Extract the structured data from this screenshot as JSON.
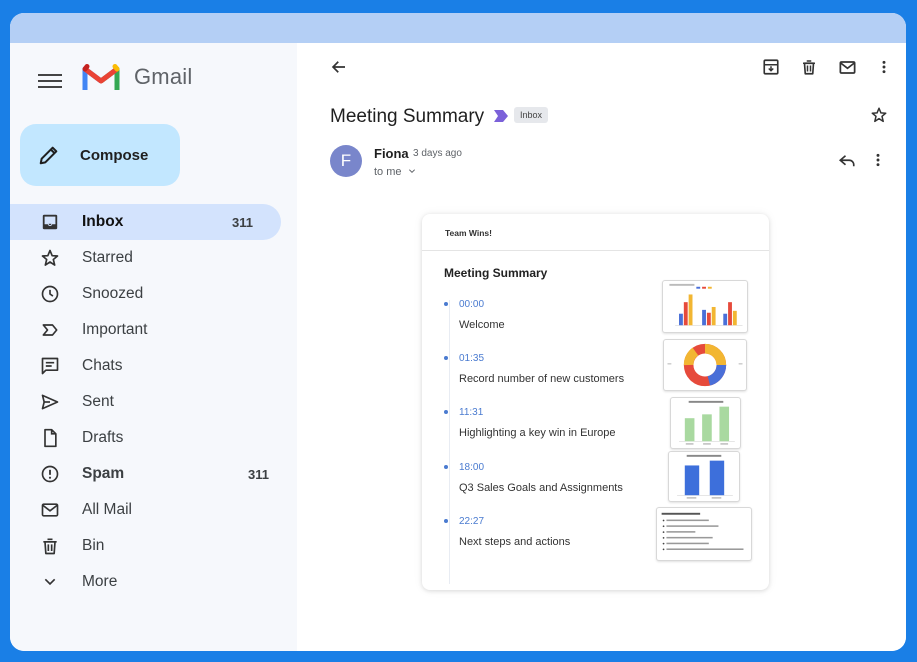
{
  "app": {
    "name": "Gmail"
  },
  "sidebar": {
    "compose_label": "Compose",
    "items": [
      {
        "label": "Inbox",
        "count": "311",
        "icon": "inbox-icon"
      },
      {
        "label": "Starred",
        "count": "",
        "icon": "star-icon"
      },
      {
        "label": "Snoozed",
        "count": "",
        "icon": "clock-icon"
      },
      {
        "label": "Important",
        "count": "",
        "icon": "important-icon"
      },
      {
        "label": "Chats",
        "count": "",
        "icon": "chat-icon"
      },
      {
        "label": "Sent",
        "count": "",
        "icon": "send-icon"
      },
      {
        "label": "Drafts",
        "count": "",
        "icon": "draft-icon"
      },
      {
        "label": "Spam",
        "count": "311",
        "icon": "spam-icon"
      },
      {
        "label": "All Mail",
        "count": "",
        "icon": "mail-icon"
      },
      {
        "label": "Bin",
        "count": "",
        "icon": "trash-icon"
      },
      {
        "label": "More",
        "count": "",
        "icon": "chevron-down-icon"
      }
    ]
  },
  "email": {
    "subject": "Meeting Summary",
    "label_chip": "Inbox",
    "sender": "Fiona",
    "avatar_letter": "F",
    "time": "3 days ago",
    "recipient": "to me"
  },
  "card": {
    "header": "Team Wins!",
    "title": "Meeting Summary",
    "items": [
      {
        "time": "00:00",
        "text": "Welcome"
      },
      {
        "time": "01:35",
        "text": "Record number of new customers"
      },
      {
        "time": "11:31",
        "text": "Highlighting a key win in Europe"
      },
      {
        "time": "18:00",
        "text": "Q3 Sales Goals and Assignments"
      },
      {
        "time": "22:27",
        "text": "Next steps and actions"
      }
    ]
  },
  "colors": {
    "accent": "#1a7fe6",
    "compose_bg": "#c2e7ff",
    "active_nav": "#d3e3fd",
    "avatar": "#7986cb",
    "timeline": "#4a7bd0"
  }
}
